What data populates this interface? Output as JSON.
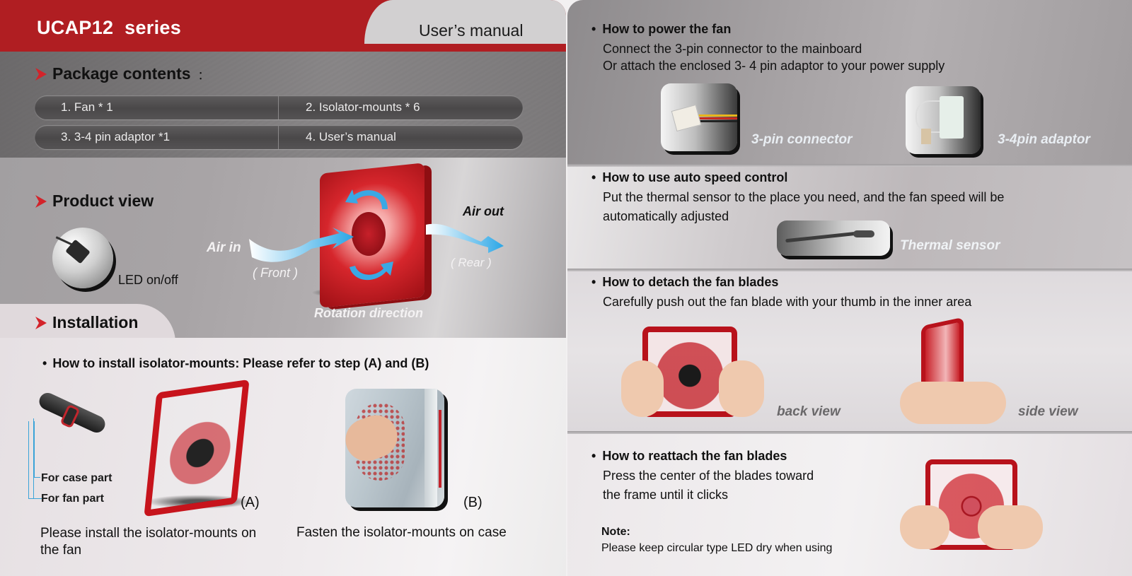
{
  "header": {
    "brand": "UCAP12  series",
    "doc_type": "User’s manual",
    "colors": {
      "brand_red": "#b01e22",
      "tab_gray": "#d2d0d1",
      "accent_blue": "#3aa3d8"
    }
  },
  "package": {
    "title": "Package contents",
    "colon": "：",
    "items": [
      "1.  Fan * 1",
      "2.  Isolator-mounts * 6",
      "3.  3-4 pin adaptor *1",
      "4.  User’s manual"
    ]
  },
  "product_view": {
    "title": "Product view",
    "led_label": "LED on/off",
    "air_in": "Air in",
    "front": "( Front )",
    "air_out": "Air out",
    "rear": "( Rear )",
    "rotation": "Rotation direction",
    "icons": [
      "led-switch-photo",
      "fan-photo",
      "airflow-arrow",
      "rotation-arrow"
    ]
  },
  "installation": {
    "title": "Installation",
    "bullet": "How to install isolator-mounts: Please refer to step (A) and (B)",
    "for_case": "For case part",
    "for_fan": "For fan part",
    "step_a": "(A)",
    "step_b": "(B)",
    "caption_a": "Please install the isolator-mounts on the fan",
    "caption_b": "Fasten the isolator-mounts on case"
  },
  "power": {
    "heading": "How to power the fan",
    "lines": [
      "Connect the 3-pin connector to the mainboard",
      "Or attach the enclosed 3- 4 pin adaptor to your power supply"
    ],
    "cap_connector": "3-pin connector",
    "cap_adaptor": "3-4pin adaptor"
  },
  "auto_speed": {
    "heading": "How to use auto speed control",
    "lines": [
      "Put the thermal sensor to the place you need, and the fan speed will be",
      "automatically adjusted"
    ],
    "cap_sensor": "Thermal sensor"
  },
  "detach": {
    "heading": "How to detach the fan blades",
    "line": "Carefully push out the fan blade with your thumb in the inner area",
    "cap_back": "back view",
    "cap_side": "side view"
  },
  "reattach": {
    "heading": "How to reattach the fan blades",
    "lines": [
      "Press the center of the blades toward",
      "the frame until it clicks"
    ],
    "note_heading": "Note:",
    "note_text": "Please keep circular type LED dry when using"
  },
  "bullet_char": "•"
}
